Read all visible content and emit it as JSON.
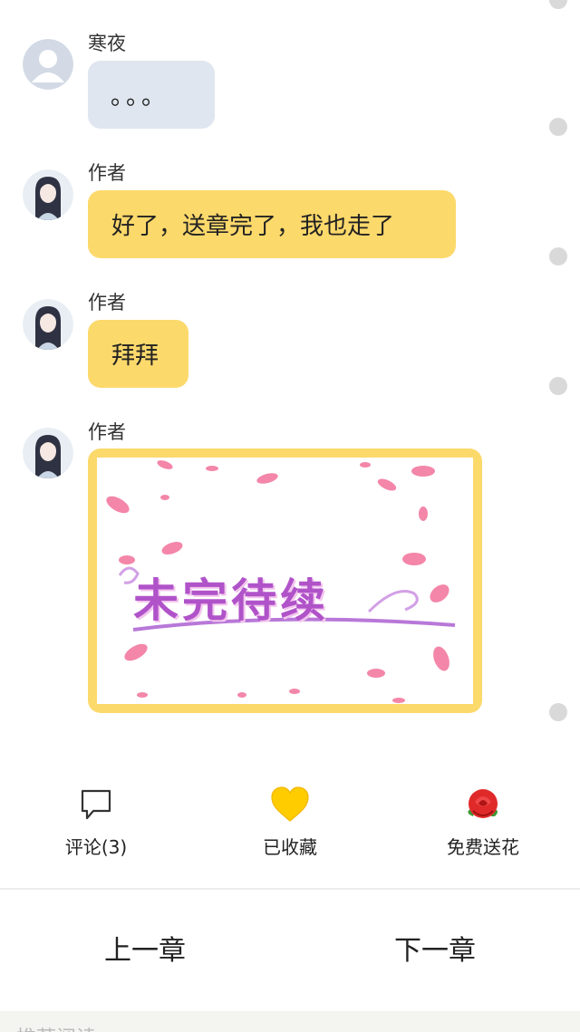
{
  "messages": [
    {
      "sender": "寒夜",
      "text": "。。。",
      "style": "gray"
    },
    {
      "sender": "作者",
      "text": "好了，送章完了，我也走了",
      "style": "yellow"
    },
    {
      "sender": "作者",
      "text": "拜拜",
      "style": "yellow"
    },
    {
      "sender": "作者",
      "image_text": "未完待续",
      "style": "yellow-image"
    }
  ],
  "actions": {
    "comment_label": "评论(3)",
    "favorite_label": "已收藏",
    "flower_label": "免费送花"
  },
  "chapter_nav": {
    "prev_label": "上一章",
    "next_label": "下一章"
  },
  "footer": {
    "partial_text": "推荐阅读"
  },
  "colors": {
    "bubble_yellow": "#fcd96b",
    "bubble_gray": "#dfe6ef",
    "heart": "#ffcc00",
    "rose": "#e02a2a"
  },
  "icons": [
    "comment-icon",
    "heart-icon",
    "rose-icon",
    "default-avatar-icon",
    "author-avatar-icon"
  ]
}
